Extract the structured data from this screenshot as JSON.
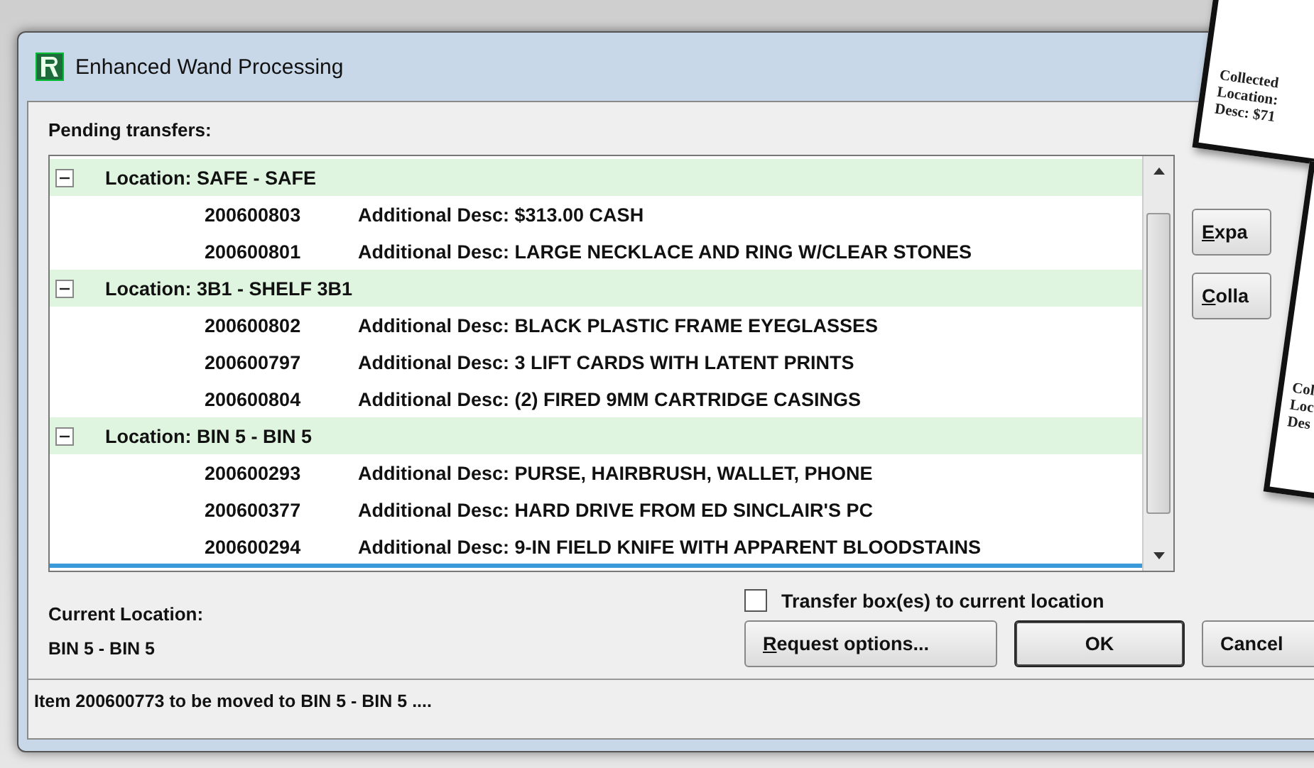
{
  "window": {
    "title": "Enhanced Wand Processing"
  },
  "pending_label": "Pending transfers:",
  "tree": [
    {
      "label": "Location: SAFE - SAFE",
      "expanded": true,
      "children": [
        {
          "id": "200600803",
          "desc": "Additional Desc: $313.00 CASH"
        },
        {
          "id": "200600801",
          "desc": "Additional Desc: LARGE NECKLACE AND RING W/CLEAR STONES"
        }
      ]
    },
    {
      "label": "Location: 3B1 - SHELF 3B1",
      "expanded": true,
      "children": [
        {
          "id": "200600802",
          "desc": "Additional Desc: BLACK PLASTIC FRAME EYEGLASSES"
        },
        {
          "id": "200600797",
          "desc": "Additional Desc: 3 LIFT CARDS WITH LATENT PRINTS"
        },
        {
          "id": "200600804",
          "desc": "Additional Desc: (2) FIRED 9MM CARTRIDGE CASINGS"
        }
      ]
    },
    {
      "label": "Location: BIN 5 - BIN 5",
      "expanded": true,
      "children": [
        {
          "id": "200600293",
          "desc": "Additional Desc: PURSE, HAIRBRUSH, WALLET, PHONE"
        },
        {
          "id": "200600377",
          "desc": "Additional Desc: HARD DRIVE FROM ED SINCLAIR'S PC"
        },
        {
          "id": "200600294",
          "desc": "Additional Desc: 9-IN FIELD KNIFE WITH APPARENT BLOODSTAINS"
        }
      ]
    }
  ],
  "side_buttons": [
    {
      "label": "Expa",
      "mnemonic": true
    },
    {
      "label": "Colla",
      "mnemonic": true
    }
  ],
  "current_location": {
    "label": "Current Location:",
    "value": "BIN 5 - BIN 5"
  },
  "transfer_checkbox": {
    "label": "Transfer box(es) to current location",
    "checked": false
  },
  "buttons": [
    {
      "label": "Request options...",
      "mnemonic": true,
      "default": false
    },
    {
      "label": "OK",
      "mnemonic": false,
      "default": true
    },
    {
      "label": "Cancel",
      "mnemonic": false,
      "default": false
    }
  ],
  "status_bar": "Item 200600773 to be moved to BIN 5 - BIN 5 ....",
  "cards": [
    {
      "lines": [
        "Collected",
        "Location:",
        "Desc: $71"
      ]
    },
    {
      "lines": [
        "Col",
        "Loc",
        "Des"
      ]
    }
  ]
}
